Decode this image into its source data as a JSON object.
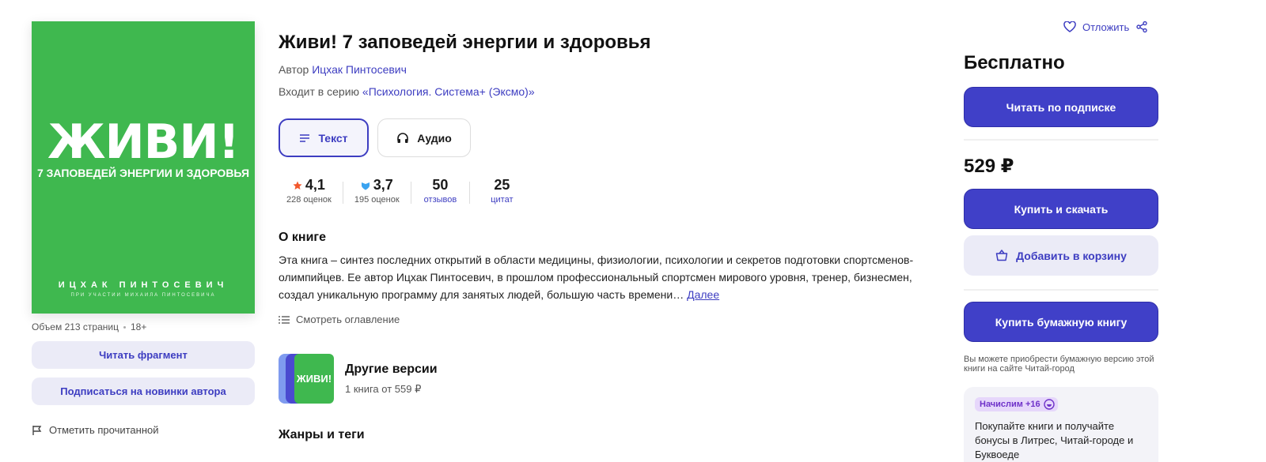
{
  "cover": {
    "title": "ЖИВИ!",
    "subtitle": "7 ЗАПОВЕДЕЙ ЭНЕРГИИ И ЗДОРОВЬЯ",
    "author": "ИЦХАК ПИНТОСЕВИЧ",
    "coauthor": "ПРИ УЧАСТИИ МИХАИЛА ПИНТОСЕВИЧА",
    "color": "#3fb84f"
  },
  "meta": {
    "pages": "Объем 213 страниц",
    "age": "18+"
  },
  "left_buttons": {
    "read_fragment": "Читать фрагмент",
    "subscribe_author": "Подписаться на новинки автора",
    "mark_read": "Отметить прочитанной"
  },
  "book": {
    "title": "Живи! 7 заповедей энергии и здоровья",
    "author_label": "Автор",
    "author_name": "Ицхак Пинтосевич",
    "series_label": "Входит в серию",
    "series_name": "«Психология. Система+ (Эксмо)»"
  },
  "formats": {
    "text": "Текст",
    "audio": "Аудио"
  },
  "stats": {
    "rating_litres": "4,1",
    "rating_litres_count": "228 оценок",
    "rating_live": "3,7",
    "rating_live_count": "195 оценок",
    "reviews": "50",
    "reviews_label": "отзывов",
    "quotes": "25",
    "quotes_label": "цитат"
  },
  "about": {
    "heading": "О книге",
    "text": "Эта книга – синтез последних открытий в области медицины, физиологии, психологии и секретов подготовки спортсменов-олимпийцев. Ее автор Ицхак Пинтосевич, в прошлом профессиональный спортсмен мирового уровня, тренер, бизнесмен, создал уникальную программу для занятых людей, большую часть времени…",
    "more": "Далее",
    "toc": "Смотреть оглавление"
  },
  "versions": {
    "mini_title": "ЖИВИ!",
    "title": "Другие версии",
    "sub": "1 книга от 559 ₽"
  },
  "genres_heading": "Жанры и теги",
  "right": {
    "defer": "Отложить",
    "price_free": "Бесплатно",
    "read_subscription": "Читать по подписке",
    "price": "529 ₽",
    "buy_download": "Купить и скачать",
    "add_cart": "Добавить в корзину",
    "buy_paper": "Купить бумажную книгу",
    "paper_note": "Вы можете приобрести бумажную версию этой книги на сайте Читай-город",
    "bonus_badge": "Начислим +16",
    "bonus_text": "Покупайте книги и получайте бонусы в Литрес, Читай-городе и Буквоеде"
  },
  "colors": {
    "accent": "#4040c8",
    "soft": "#ebebf7",
    "star": "#f2582c",
    "shield": "#3aa3f0"
  }
}
